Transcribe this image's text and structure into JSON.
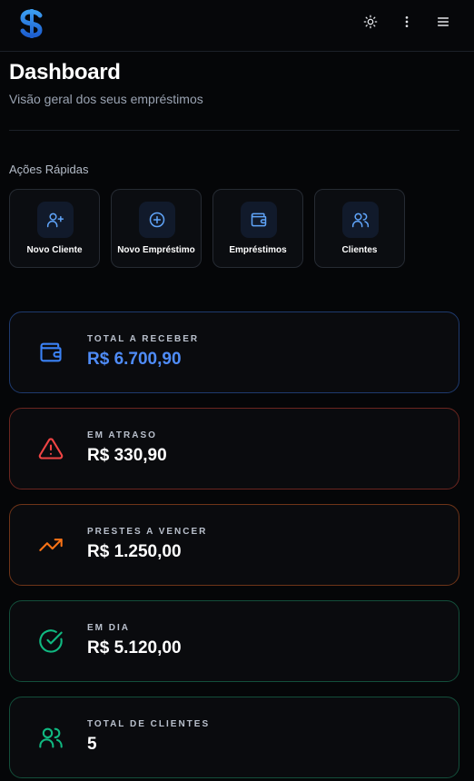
{
  "header": {
    "logo_icon": "dollar-s-logo",
    "theme_icon": "sun-icon",
    "more_icon": "more-vertical-icon",
    "menu_icon": "hamburger-menu-icon"
  },
  "page": {
    "title": "Dashboard",
    "subtitle": "Visão geral dos seus empréstimos"
  },
  "quick_actions": {
    "title": "Ações Rápidas",
    "items": [
      {
        "label": "Novo Cliente",
        "icon": "user-plus-icon"
      },
      {
        "label": "Novo Empréstimo",
        "icon": "plus-circle-icon"
      },
      {
        "label": "Empréstimos",
        "icon": "wallet-icon"
      },
      {
        "label": "Clientes",
        "icon": "users-icon"
      }
    ]
  },
  "stats": [
    {
      "label": "TOTAL A RECEBER",
      "value": "R$ 6.700,90",
      "icon": "wallet-icon",
      "color": "#3b82f6",
      "value_color": "#4f8cf7"
    },
    {
      "label": "EM ATRASO",
      "value": "R$ 330,90",
      "icon": "alert-triangle-icon",
      "color": "#ef4444",
      "value_color": "#ffffff"
    },
    {
      "label": "PRESTES A VENCER",
      "value": "R$ 1.250,00",
      "icon": "trending-up-icon",
      "color": "#f97316",
      "value_color": "#ffffff"
    },
    {
      "label": "EM DIA",
      "value": "R$ 5.120,00",
      "icon": "check-circle-icon",
      "color": "#10b981",
      "value_color": "#ffffff"
    },
    {
      "label": "TOTAL DE CLIENTES",
      "value": "5",
      "icon": "users-icon",
      "color": "#10b981",
      "value_color": "#ffffff"
    }
  ],
  "colors": {
    "background": "#050608",
    "accent_blue": "#3b82f6",
    "danger_red": "#ef4444",
    "warning_orange": "#f97316",
    "success_green": "#10b981"
  }
}
